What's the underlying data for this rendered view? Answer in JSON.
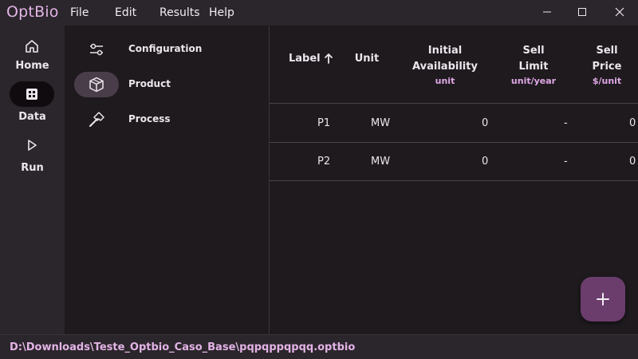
{
  "app": {
    "title": "OptBio"
  },
  "menu": {
    "file": "File",
    "edit": "Edit",
    "results": "Results",
    "help": "Help"
  },
  "rail": {
    "items": [
      {
        "label": "Home",
        "icon": "home-icon"
      },
      {
        "label": "Data",
        "icon": "grid-icon",
        "active": true
      },
      {
        "label": "Run",
        "icon": "play-icon"
      }
    ]
  },
  "subnav": {
    "items": [
      {
        "label": "Configuration",
        "icon": "sliders-icon"
      },
      {
        "label": "Product",
        "icon": "cube-icon",
        "active": true
      },
      {
        "label": "Process",
        "icon": "hammer-icon"
      }
    ]
  },
  "table": {
    "columns": [
      {
        "title": "Label",
        "sorted": "ascending"
      },
      {
        "title": "Unit"
      },
      {
        "title_line1": "Initial",
        "title_line2": "Availability",
        "unit": "unit"
      },
      {
        "title_line1": "Sell",
        "title_line2": "Limit",
        "unit": "unit/year"
      },
      {
        "title_line1": "Sell",
        "title_line2": "Price",
        "unit": "$/unit"
      }
    ],
    "rows": [
      {
        "label": "P1",
        "unit": "MW",
        "initial_availability": "0",
        "sell_limit": "-",
        "sell_price": "0"
      },
      {
        "label": "P2",
        "unit": "MW",
        "initial_availability": "0",
        "sell_limit": "-",
        "sell_price": "0"
      }
    ]
  },
  "fab": {
    "icon": "plus-icon"
  },
  "status": {
    "path": "D:\\Downloads\\Teste_Optbio_Caso_Base\\pqpqppqpqq.optbio"
  },
  "colors": {
    "accent": "#e3b4e7",
    "fab": "#6a3d6c",
    "active_pill": "#4a3d4a",
    "background": "#1e1a1e",
    "surface": "#2b262b"
  }
}
